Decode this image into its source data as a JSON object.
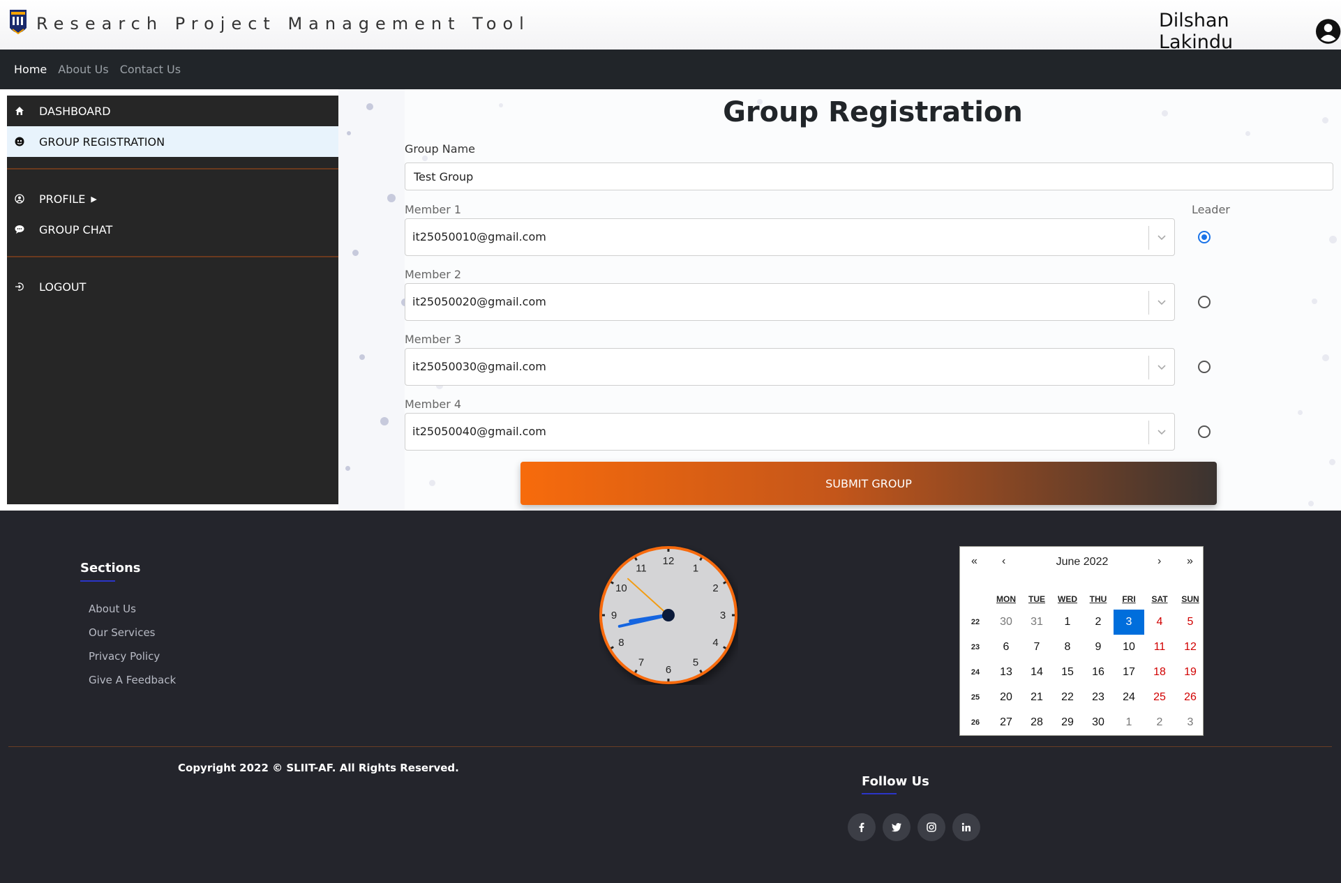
{
  "header": {
    "title": "Research Project Management Tool",
    "user_name": "Dilshan Lakindu"
  },
  "nav": {
    "items": [
      "Home",
      "About Us",
      "Contact Us"
    ],
    "active": "Home"
  },
  "sidebar": {
    "items": [
      {
        "label": "DASHBOARD",
        "icon": "home-icon"
      },
      {
        "label": "GROUP REGISTRATION",
        "icon": "group-icon"
      },
      {
        "label": "PROFILE",
        "icon": "profile-icon"
      },
      {
        "label": "GROUP CHAT",
        "icon": "chat-icon"
      },
      {
        "label": "LOGOUT",
        "icon": "logout-icon"
      }
    ],
    "active": "GROUP REGISTRATION"
  },
  "form": {
    "title": "Group Registration",
    "group_name_label": "Group Name",
    "group_name_value": "Test Group",
    "leader_label": "Leader",
    "members": [
      {
        "label": "Member 1",
        "value": "it25050010@gmail.com",
        "leader": true
      },
      {
        "label": "Member 2",
        "value": "it25050020@gmail.com",
        "leader": false
      },
      {
        "label": "Member 3",
        "value": "it25050030@gmail.com",
        "leader": false
      },
      {
        "label": "Member 4",
        "value": "it25050040@gmail.com",
        "leader": false
      }
    ],
    "submit_label": "SUBMIT GROUP"
  },
  "footer": {
    "sections_title": "Sections",
    "links": [
      "About Us",
      "Our Services",
      "Privacy Policy",
      "Give A Feedback"
    ],
    "copyright": "Copyright 2022 © SLIIT-AF. All Rights Reserved.",
    "follow_title": "Follow Us",
    "social": [
      "facebook-icon",
      "twitter-icon",
      "instagram-icon",
      "linkedin-icon"
    ]
  },
  "clock": {
    "numbers": [
      "12",
      "1",
      "2",
      "3",
      "4",
      "5",
      "6",
      "7",
      "8",
      "9",
      "10",
      "11"
    ],
    "time": "8:42:52"
  },
  "calendar": {
    "label": "June 2022",
    "nav": {
      "prev2": "«",
      "prev": "‹",
      "next": "›",
      "next2": "»"
    },
    "weekdays": [
      "MON",
      "TUE",
      "WED",
      "THU",
      "FRI",
      "SAT",
      "SUN"
    ],
    "weeks": [
      {
        "num": "22",
        "days": [
          "30",
          "31",
          "1",
          "2",
          "3",
          "4",
          "5"
        ]
      },
      {
        "num": "23",
        "days": [
          "6",
          "7",
          "8",
          "9",
          "10",
          "11",
          "12"
        ]
      },
      {
        "num": "24",
        "days": [
          "13",
          "14",
          "15",
          "16",
          "17",
          "18",
          "19"
        ]
      },
      {
        "num": "25",
        "days": [
          "20",
          "21",
          "22",
          "23",
          "24",
          "25",
          "26"
        ]
      },
      {
        "num": "26",
        "days": [
          "27",
          "28",
          "29",
          "30",
          "1",
          "2",
          "3"
        ]
      }
    ],
    "selected_day": "3",
    "colors": {
      "selected": "#006edc",
      "weekend": "#d10000",
      "accent": "#f76b0c"
    }
  }
}
